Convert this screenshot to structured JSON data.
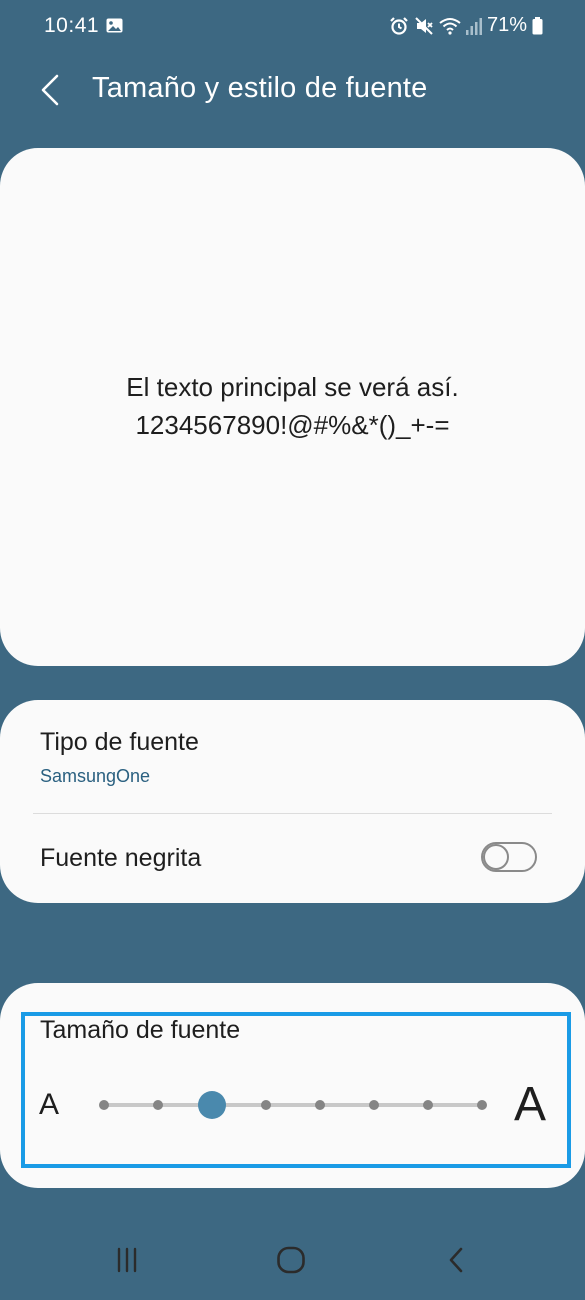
{
  "status_bar": {
    "time": "10:41",
    "battery": "71%",
    "icons": [
      "gallery-icon",
      "alarm-icon",
      "mute-icon",
      "wifi-icon",
      "signal-icon",
      "battery-icon"
    ]
  },
  "header": {
    "title": "Tamaño y estilo de fuente",
    "back_icon": "chevron-left-icon"
  },
  "preview": {
    "line1": "El texto principal se verá así.",
    "line2": "1234567890!@#%&*()_+-="
  },
  "font_settings": {
    "font_type_label": "Tipo de fuente",
    "font_type_value": "SamsungOne",
    "bold_label": "Fuente negrita",
    "bold_enabled": false
  },
  "font_size": {
    "label": "Tamaño de fuente",
    "small_glyph": "A",
    "large_glyph": "A",
    "steps": 8,
    "selected_index": 2
  },
  "nav_bar": {
    "icons": [
      "recent-apps-icon",
      "home-icon",
      "back-icon"
    ]
  },
  "colors": {
    "background": "#3d6882",
    "card": "#fafafa",
    "accent": "#4a89ad",
    "highlight": "#1a9be6",
    "link": "#2a6080"
  }
}
